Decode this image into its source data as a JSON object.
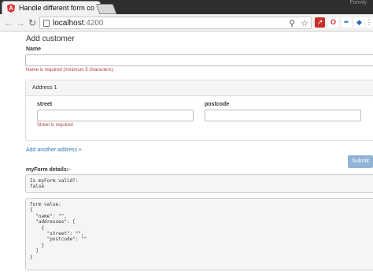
{
  "browser": {
    "tab_title": "Handle different form co",
    "tab_favicon": "A",
    "user_label": "Formly",
    "url_host": "localhost",
    "url_port": ":4200",
    "icons": [
      "back-arrow-icon",
      "forward-arrow-icon",
      "reload-icon",
      "search-icon",
      "star-icon",
      "menu-icon"
    ]
  },
  "form": {
    "heading": "Add customer",
    "name_label": "Name",
    "name_value": "",
    "name_error": "Name is required (minimum 5 characters).",
    "address_title": "Address 1",
    "street_label": "street",
    "street_value": "",
    "street_error": "Street is required",
    "postcode_label": "postcode",
    "postcode_value": "",
    "add_link": "Add another address +",
    "submit_label": "Submit"
  },
  "details": {
    "heading": "myForm details:-",
    "valid_lines": [
      "Is myForm valid?:",
      "false"
    ],
    "value_lines": [
      "form value:",
      "{",
      "  \"name\": \"\",",
      "  \"addresses\": [",
      "    {",
      "      \"street\": \"\",",
      "      \"postcode\": \"\"",
      "    }",
      "  ]",
      "}"
    ]
  },
  "colors": {
    "error": "#a94442",
    "link": "#337ab7",
    "submit": "#8fb4d6"
  }
}
